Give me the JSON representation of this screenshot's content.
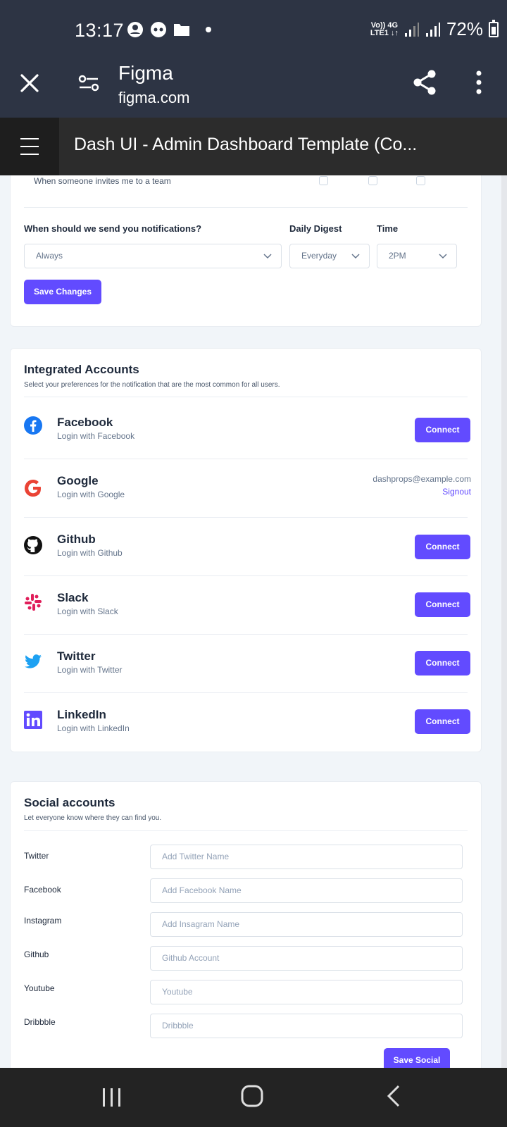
{
  "status_bar": {
    "time": "13:17",
    "net_top": "Vo)) 4G",
    "net_bottom": "LTE1 ↓↑",
    "battery": "72%"
  },
  "browser": {
    "title": "Figma",
    "url": "figma.com"
  },
  "file_bar": {
    "title": "Dash UI - Admin Dashboard Template (Co..."
  },
  "notifications": {
    "invite_label": "When someone invites me to a team",
    "when_label": "When should we send you notifications?",
    "when_value": "Always",
    "digest_label": "Daily Digest",
    "digest_value": "Everyday",
    "time_label": "Time",
    "time_value": "2PM",
    "save_label": "Save Changes"
  },
  "integrated": {
    "title": "Integrated Accounts",
    "subtitle": "Select your preferences for the notification that are the most common for all users.",
    "accounts": [
      {
        "name": "Facebook",
        "sub": "Login with Facebook",
        "action": "Connect"
      },
      {
        "name": "Google",
        "sub": "Login with Google",
        "email": "dashprops@example.com",
        "signout": "Signout"
      },
      {
        "name": "Github",
        "sub": "Login with Github",
        "action": "Connect"
      },
      {
        "name": "Slack",
        "sub": "Login with Slack",
        "action": "Connect"
      },
      {
        "name": "Twitter",
        "sub": "Login with Twitter",
        "action": "Connect"
      },
      {
        "name": "LinkedIn",
        "sub": "Login with LinkedIn",
        "action": "Connect"
      }
    ]
  },
  "social": {
    "title": "Social accounts",
    "subtitle": "Let everyone know where they can find you.",
    "fields": [
      {
        "label": "Twitter",
        "placeholder": "Add Twitter Name"
      },
      {
        "label": "Facebook",
        "placeholder": "Add Facebook Name"
      },
      {
        "label": "Instagram",
        "placeholder": "Add Insagram Name"
      },
      {
        "label": "Github",
        "placeholder": "Github Account"
      },
      {
        "label": "Youtube",
        "placeholder": "Youtube"
      },
      {
        "label": "Dribbble",
        "placeholder": "Dribbble"
      }
    ],
    "save_label": "Save Social"
  },
  "colors": {
    "primary": "#624bff",
    "facebook": "#1877f2",
    "google": "#ea4335",
    "twitter": "#1da1f2",
    "slack": "#e01e5a",
    "linkedin": "#624bff"
  }
}
